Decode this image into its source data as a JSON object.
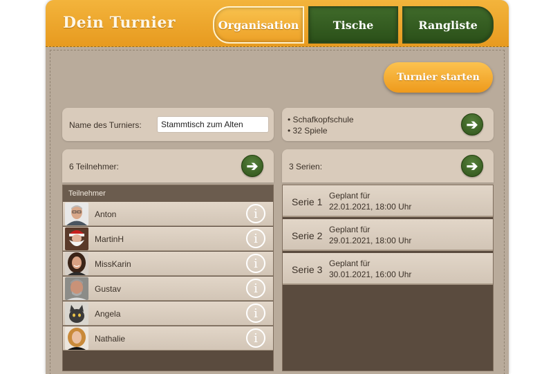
{
  "header": {
    "title": "Dein Turnier",
    "tabs": [
      {
        "label": "Organisation",
        "active": true
      },
      {
        "label": "Tische",
        "active": false
      },
      {
        "label": "Rangliste",
        "active": false
      }
    ]
  },
  "actions": {
    "start_label": "Turnier starten"
  },
  "tournament": {
    "name_label": "Name des Turniers:",
    "name_value": "Stammtisch zum Alten",
    "info_lines": [
      "• Schafkopfschule",
      "• 32 Spiele"
    ]
  },
  "participants": {
    "summary": "6 Teilnehmer:",
    "column_header": "Teilnehmer",
    "items": [
      {
        "name": "Anton"
      },
      {
        "name": "MartinH"
      },
      {
        "name": "MissKarin"
      },
      {
        "name": "Gustav"
      },
      {
        "name": "Angela"
      },
      {
        "name": "Nathalie"
      }
    ]
  },
  "series": {
    "summary": "3 Serien:",
    "items": [
      {
        "name": "Serie 1",
        "line1": "Geplant für",
        "line2": "22.01.2021, 18:00 Uhr"
      },
      {
        "name": "Serie 2",
        "line1": "Geplant für",
        "line2": "29.01.2021, 18:00 Uhr"
      },
      {
        "name": "Serie 3",
        "line1": "Geplant für",
        "line2": "30.01.2021, 16:00 Uhr"
      }
    ]
  },
  "icons": {
    "arrow": "arrow-right-icon",
    "info": "info-icon"
  },
  "colors": {
    "accent_orange": "#eda127",
    "tab_green": "#2b5019",
    "panel_bg": "#d9cbbb",
    "list_bg": "#5a4b3e"
  }
}
